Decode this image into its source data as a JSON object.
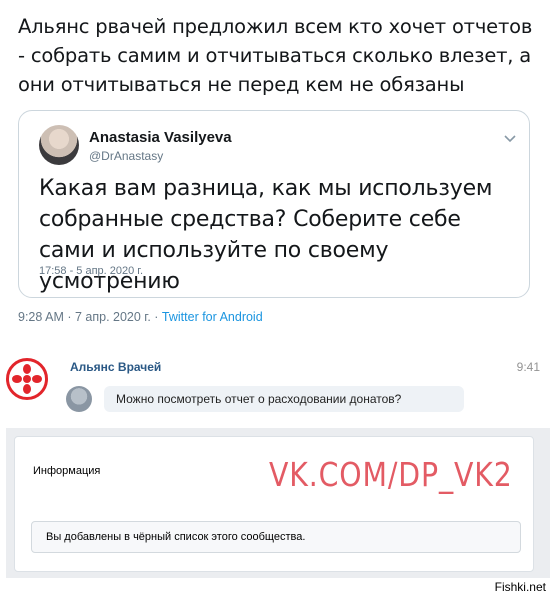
{
  "post": {
    "text": "Альянс рвачей предложил всем кто хочет отчетов - собрать самим и отчитываться сколько влезет, а они отчитываться не перед кем не обязаны"
  },
  "quote_tweet": {
    "name": "Anastasia Vasilyeva",
    "handle": "@DrAnastasy",
    "body": "Какая вам разница, как мы используем собранные средства? Соберите себе сами и используйте по своему усмотрению",
    "time": "17:58 - 5 апр. 2020 г."
  },
  "tweet_meta": {
    "time": "9:28 AM · 7 апр. 2020 г. · ",
    "source": "Twitter for Android"
  },
  "vk_message": {
    "sender": "Альянс Врачей",
    "time": "9:41",
    "text": "Можно посмотреть отчет о расходовании донатов?"
  },
  "vk_info": {
    "title": "Информация",
    "watermark": "VK.COM/DP_VK2",
    "banned_text": "Вы добавлены в чёрный список этого сообщества."
  },
  "site_watermark": "Fishki.net",
  "colors": {
    "twitter_blue": "#1b95e0",
    "vk_link": "#2a5885",
    "logo_red": "#e2252b",
    "watermark_red": "#e35b64"
  }
}
